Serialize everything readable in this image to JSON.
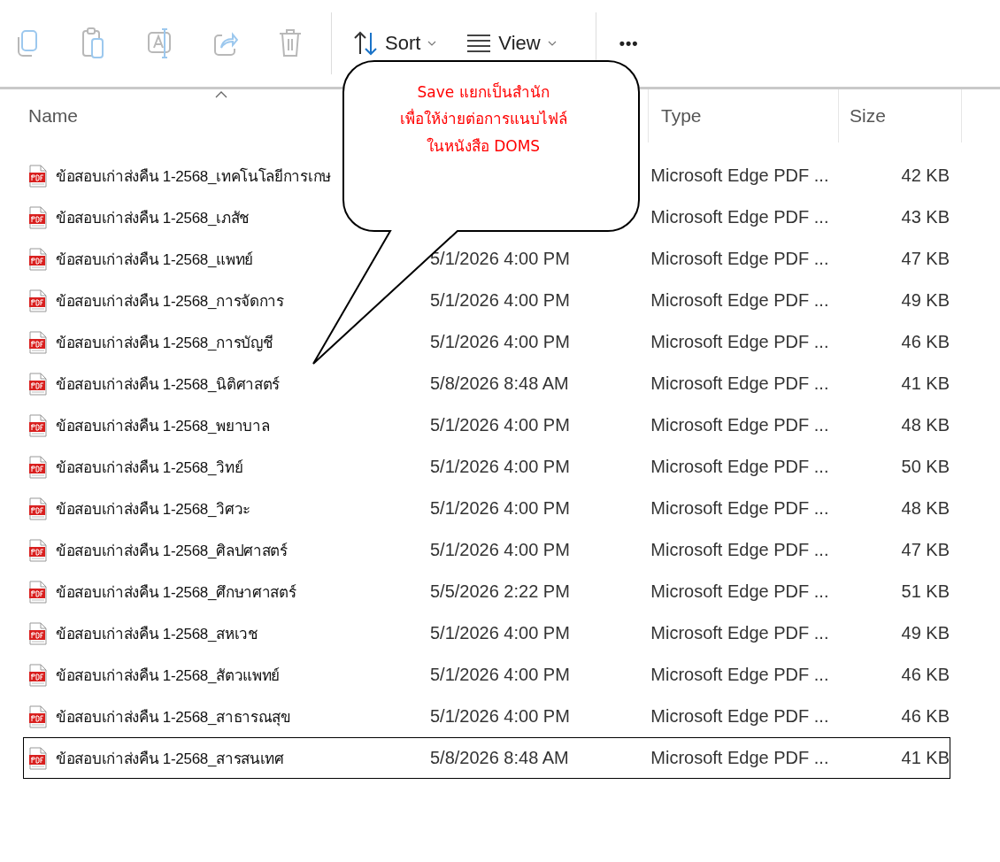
{
  "toolbar": {
    "actions": [
      {
        "kind": "copy",
        "disabled": true
      },
      {
        "kind": "paste",
        "disabled": true
      },
      {
        "kind": "rename",
        "disabled": true
      },
      {
        "kind": "share",
        "disabled": true
      },
      {
        "kind": "delete",
        "disabled": true
      }
    ],
    "sort": {
      "label": "Sort"
    },
    "view": {
      "label": "View"
    },
    "more": "•••"
  },
  "columns": [
    {
      "label": "Name",
      "sorted": true
    },
    {
      "label": "Type",
      "sorted": false
    },
    {
      "label": "Size",
      "sorted": false
    }
  ],
  "rows": [
    {
      "name": "ข้อสอบเก่าส่งคืน 1-2568_เทคโนโลยีการเกษ",
      "type": "Microsoft Edge PDF ...",
      "size": "42 KB",
      "selected": false
    },
    {
      "name": "ข้อสอบเก่าส่งคืน 1-2568_เภสัช",
      "type": "Microsoft Edge PDF ...",
      "size": "43 KB",
      "selected": false
    },
    {
      "name": "ข้อสอบเก่าส่งคืน 1-2568_แพทย์",
      "date": "5/1/2026 4:00 PM",
      "type": "Microsoft Edge PDF ...",
      "size": "47 KB",
      "selected": false
    },
    {
      "name": "ข้อสอบเก่าส่งคืน 1-2568_การจัดการ",
      "date": "5/1/2026 4:00 PM",
      "type": "Microsoft Edge PDF ...",
      "size": "49 KB",
      "selected": false
    },
    {
      "name": "ข้อสอบเก่าส่งคืน 1-2568_การบัญชี",
      "date": "5/1/2026 4:00 PM",
      "type": "Microsoft Edge PDF ...",
      "size": "46 KB",
      "selected": false
    },
    {
      "name": "ข้อสอบเก่าส่งคืน 1-2568_นิติศาสตร์",
      "date": "5/8/2026 8:48 AM",
      "type": "Microsoft Edge PDF ...",
      "size": "41 KB",
      "selected": false
    },
    {
      "name": "ข้อสอบเก่าส่งคืน 1-2568_พยาบาล",
      "date": "5/1/2026 4:00 PM",
      "type": "Microsoft Edge PDF ...",
      "size": "48 KB",
      "selected": false
    },
    {
      "name": "ข้อสอบเก่าส่งคืน 1-2568_วิทย์",
      "date": "5/1/2026 4:00 PM",
      "type": "Microsoft Edge PDF ...",
      "size": "50 KB",
      "selected": false
    },
    {
      "name": "ข้อสอบเก่าส่งคืน 1-2568_วิศวะ",
      "date": "5/1/2026 4:00 PM",
      "type": "Microsoft Edge PDF ...",
      "size": "48 KB",
      "selected": false
    },
    {
      "name": "ข้อสอบเก่าส่งคืน 1-2568_ศิลปศาสตร์",
      "date": "5/1/2026 4:00 PM",
      "type": "Microsoft Edge PDF ...",
      "size": "47 KB",
      "selected": false
    },
    {
      "name": "ข้อสอบเก่าส่งคืน 1-2568_ศึกษาศาสตร์",
      "date": "5/5/2026 2:22 PM",
      "type": "Microsoft Edge PDF ...",
      "size": "51 KB",
      "selected": false
    },
    {
      "name": "ข้อสอบเก่าส่งคืน 1-2568_สหเวช",
      "date": "5/1/2026 4:00 PM",
      "type": "Microsoft Edge PDF ...",
      "size": "49 KB",
      "selected": false
    },
    {
      "name": "ข้อสอบเก่าส่งคืน 1-2568_สัตวแพทย์",
      "date": "5/1/2026 4:00 PM",
      "type": "Microsoft Edge PDF ...",
      "size": "46 KB",
      "selected": false
    },
    {
      "name": "ข้อสอบเก่าส่งคืน 1-2568_สาธารณสุข",
      "date": "5/1/2026 4:00 PM",
      "type": "Microsoft Edge PDF ...",
      "size": "46 KB",
      "selected": false
    },
    {
      "name": "ข้อสอบเก่าส่งคืน 1-2568_สารสนเทศ",
      "date": "5/8/2026 8:48 AM",
      "type": "Microsoft Edge PDF ...",
      "size": "41 KB",
      "selected": true
    }
  ],
  "callout": {
    "lines": [
      "Save แยกเป็นสำนัก",
      "เพื่อให้ง่ายต่อการแนบไฟล์",
      "ในหนังสือ DOMS"
    ]
  }
}
